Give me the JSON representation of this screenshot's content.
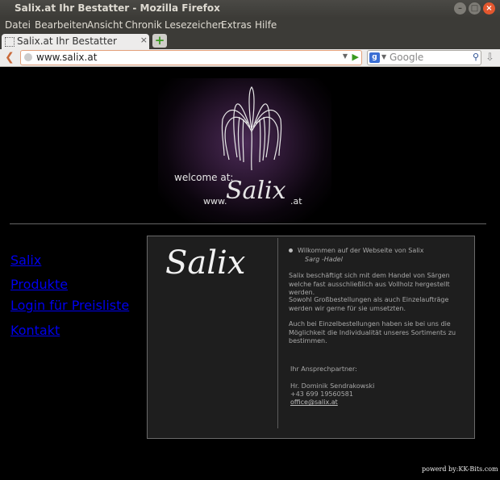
{
  "window": {
    "title": "Salix.at Ihr Bestatter - Mozilla Firefox"
  },
  "menu": [
    "Datei",
    "Bearbeiten",
    "Ansicht",
    "Chronik",
    "Lesezeichen",
    "Extras",
    "Hilfe"
  ],
  "tab": {
    "title": "Salix.at Ihr Bestatter",
    "close": "×"
  },
  "newtab": {
    "label": "+"
  },
  "navbar": {
    "url": "www.salix.at",
    "search_placeholder": "Google",
    "engine": "g"
  },
  "hero": {
    "welcome": "welcome at:",
    "www": "www.",
    "logo": "Salix",
    "tld": ".at"
  },
  "sitenav": [
    "Salix",
    "Produkte",
    "Login für Preisliste",
    "Kontakt"
  ],
  "box": {
    "title": "Salix",
    "welcome": "Wilkommen auf der Webseite von Salix",
    "signature": "Sarg -Hadel",
    "para1": "Salix beschäftigt sich mit dem Handel von Särgen welche fast ausschließlich aus Vollholz hergestellt werden.",
    "para2": "Sowohl Großbestellungen als auch Einzelaufträge werden wir gerne für sie umsetzten.",
    "para3": "Auch bei Einzelbestellungen haben sie bei uns die Möglichkeit die Individualität unseres Sortiments zu bestimmen.",
    "contact_label": "Ihr Ansprechpartner:",
    "contact_name": "Hr. Dominik Sendrakowski",
    "phone": "+43 699 19560581",
    "email": "office@salix.at"
  },
  "footer": {
    "text": "powerd by:KK-Bits.com"
  },
  "colors": {
    "accent_back": "#c96a3a",
    "go_green": "#3a9a1f",
    "close_red": "#e4572e"
  },
  "icons": [
    "back-arrow-icon",
    "go-arrow-icon",
    "search-magnifier-icon",
    "download-arrow-icon",
    "favicon-placeholder-icon",
    "willow-tree-icon"
  ]
}
